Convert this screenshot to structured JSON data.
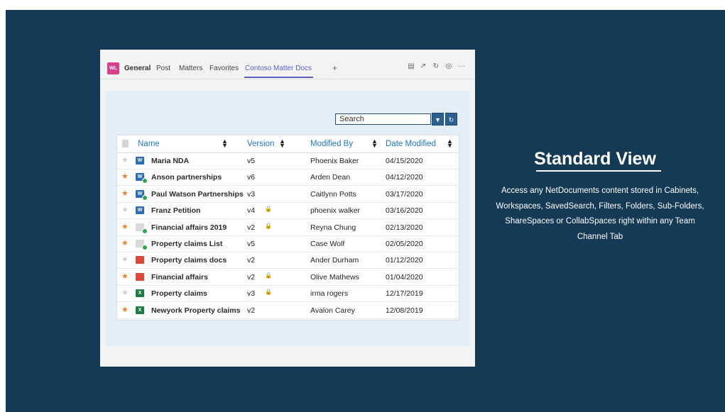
{
  "tabs": {
    "badge": "WL",
    "general": "General",
    "post": "Post",
    "matters": "Matters",
    "favorites": "Favorites",
    "active": "Contoso Matter Docs",
    "add": "+"
  },
  "search": {
    "placeholder": "Search"
  },
  "table": {
    "headers": {
      "name": "Name",
      "version": "Version",
      "modified_by": "Modified By",
      "date_modified": "Date Modified"
    },
    "rows": [
      {
        "favorite": false,
        "icon": "word-icon",
        "synced": false,
        "name": "Maria NDA",
        "version": "v5",
        "locked": false,
        "modified_by": "Phoenix Baker",
        "date": "04/15/2020"
      },
      {
        "favorite": true,
        "icon": "word-icon",
        "synced": true,
        "name": "Anson partnerships",
        "version": "v6",
        "locked": false,
        "modified_by": "Arden Dean",
        "date": "04/12/2020"
      },
      {
        "favorite": true,
        "icon": "word-icon",
        "synced": true,
        "name": "Paul Watson Partnerships",
        "version": "v3",
        "locked": false,
        "modified_by": "Caitlynn Potts",
        "date": "03/17/2020"
      },
      {
        "favorite": false,
        "icon": "word-icon",
        "synced": false,
        "name": "Franz Petition",
        "version": "v4",
        "locked": true,
        "modified_by": "phoenix walker",
        "date": "03/16/2020"
      },
      {
        "favorite": true,
        "icon": "doc-icon",
        "synced": true,
        "name": "Financial affairs  2019",
        "version": "v2",
        "locked": true,
        "modified_by": "Reyna Chung",
        "date": "02/13/2020"
      },
      {
        "favorite": true,
        "icon": "doc-icon",
        "synced": true,
        "name": "Property claims List",
        "version": "v5",
        "locked": false,
        "modified_by": "Case Wolf",
        "date": "02/05/2020"
      },
      {
        "favorite": false,
        "icon": "pdf-icon",
        "synced": false,
        "name": "Property claims docs",
        "version": "v2",
        "locked": false,
        "modified_by": "Ander Durham",
        "date": "01/12/2020"
      },
      {
        "favorite": true,
        "icon": "pdf-icon",
        "synced": false,
        "name": "Financial affairs",
        "version": "v2",
        "locked": true,
        "modified_by": "Olive Mathews",
        "date": "01/04/2020"
      },
      {
        "favorite": false,
        "icon": "excel-icon",
        "synced": false,
        "name": "Property claims",
        "version": "v3",
        "locked": true,
        "modified_by": "irma rogers",
        "date": "12/17/2019"
      },
      {
        "favorite": true,
        "icon": "excel-icon",
        "synced": false,
        "name": "Newyork Property claims",
        "version": "v2",
        "locked": false,
        "modified_by": "Avalon Carey",
        "date": "12/08/2019"
      }
    ]
  },
  "panel": {
    "heading": "Standard View",
    "description": "Access any NetDocuments content stored in Cabinets, Workspaces, SavedSearch, Filters, Folders, Sub-Folders, ShareSpaces or CollabSpaces right within any Team Channel Tab"
  },
  "colors": {
    "background": "#143a56",
    "accent": "#2278c4",
    "favorite": "#e8822c",
    "tab_active": "#5b5fc7"
  }
}
